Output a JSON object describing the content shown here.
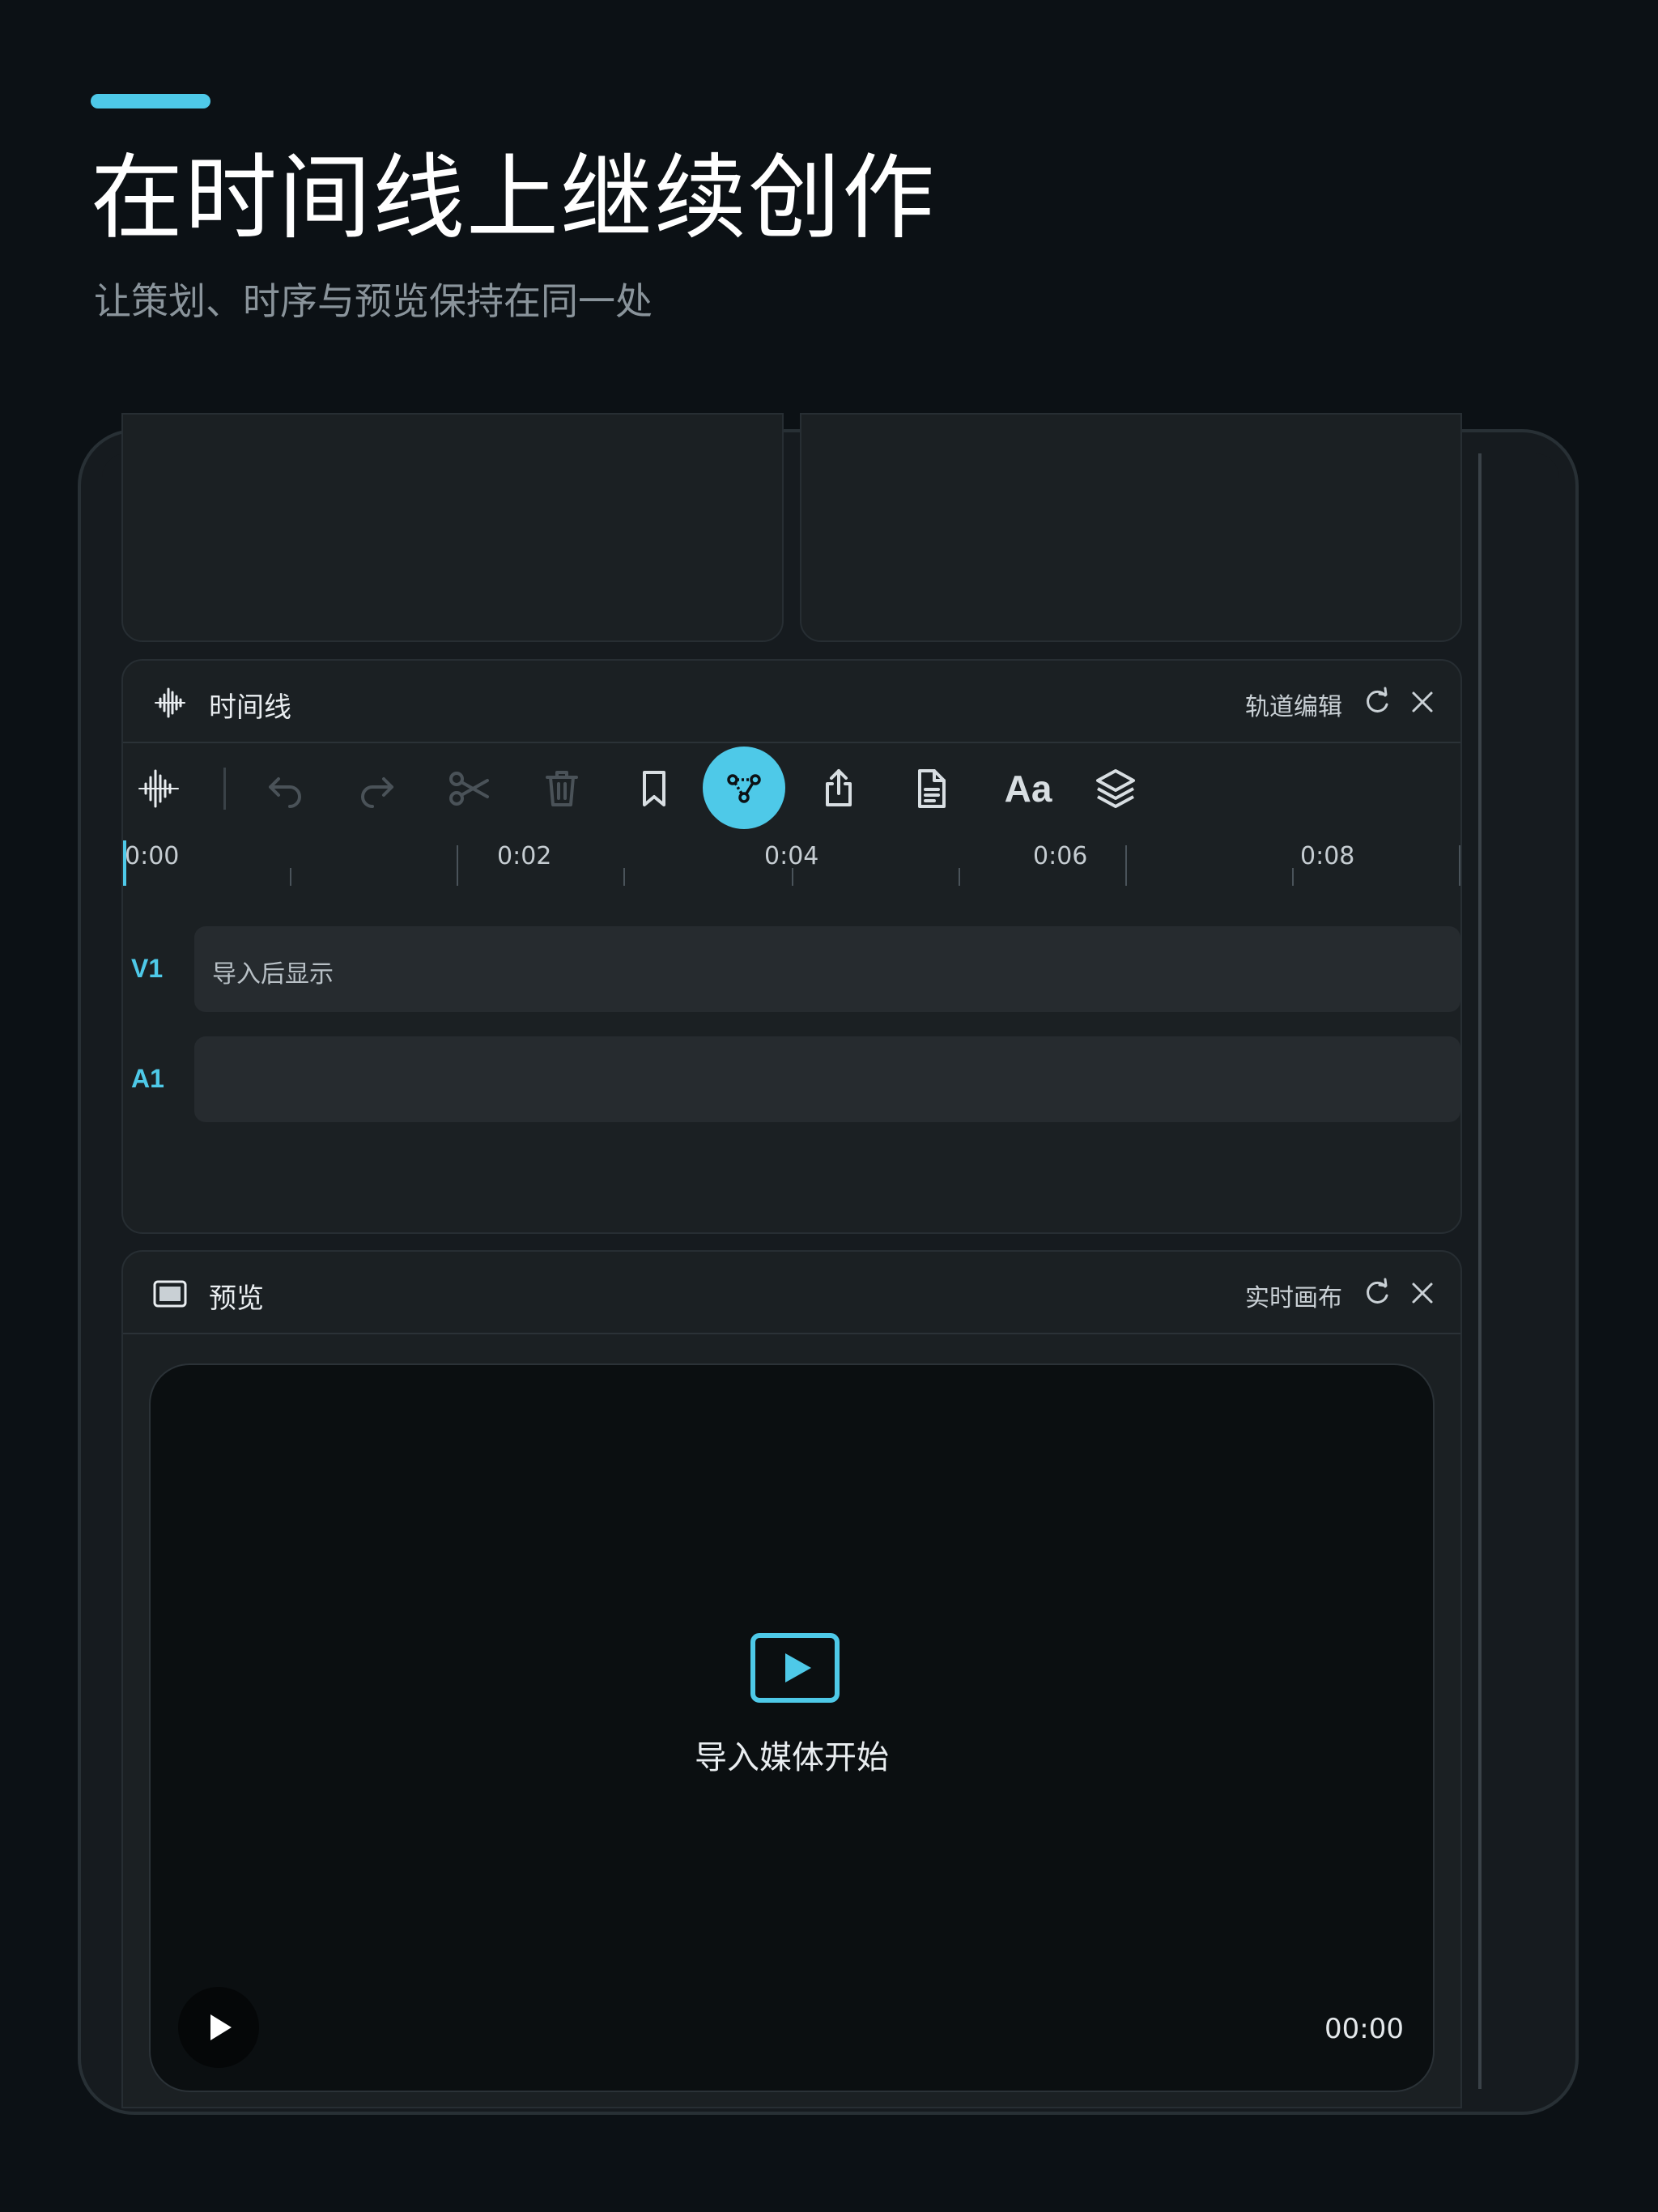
{
  "hero": {
    "title": "在时间线上继续创作",
    "subtitle": "让策划、时序与预览保持在同一处"
  },
  "timeline_panel": {
    "title": "时间线",
    "action_label": "轨道编辑",
    "icon": "waveform-icon",
    "toolbar": [
      {
        "name": "waveform-icon",
        "state": "normal"
      },
      {
        "name": "undo-icon",
        "state": "disabled"
      },
      {
        "name": "redo-icon",
        "state": "disabled"
      },
      {
        "name": "scissors-icon",
        "state": "disabled"
      },
      {
        "name": "trash-icon",
        "state": "disabled"
      },
      {
        "name": "bookmark-icon",
        "state": "normal"
      },
      {
        "name": "node-graph-icon",
        "state": "active"
      },
      {
        "name": "share-icon",
        "state": "normal"
      },
      {
        "name": "document-icon",
        "state": "normal"
      },
      {
        "name": "text-style-icon",
        "label": "Aa",
        "state": "normal"
      },
      {
        "name": "layers-icon",
        "state": "normal"
      }
    ],
    "ruler": {
      "labels": [
        "0:00",
        "0:02",
        "0:04",
        "0:06",
        "0:08"
      ]
    },
    "tracks": [
      {
        "label": "V1",
        "placeholder": "导入后显示"
      },
      {
        "label": "A1",
        "placeholder": ""
      }
    ]
  },
  "preview_panel": {
    "title": "预览",
    "action_label": "实时画布",
    "icon": "monitor-icon",
    "empty_hint": "导入媒体开始",
    "timecode": "00:00"
  },
  "colors": {
    "accent": "#4ec9e8",
    "background": "#0c1115",
    "panel": "#1b2023"
  }
}
